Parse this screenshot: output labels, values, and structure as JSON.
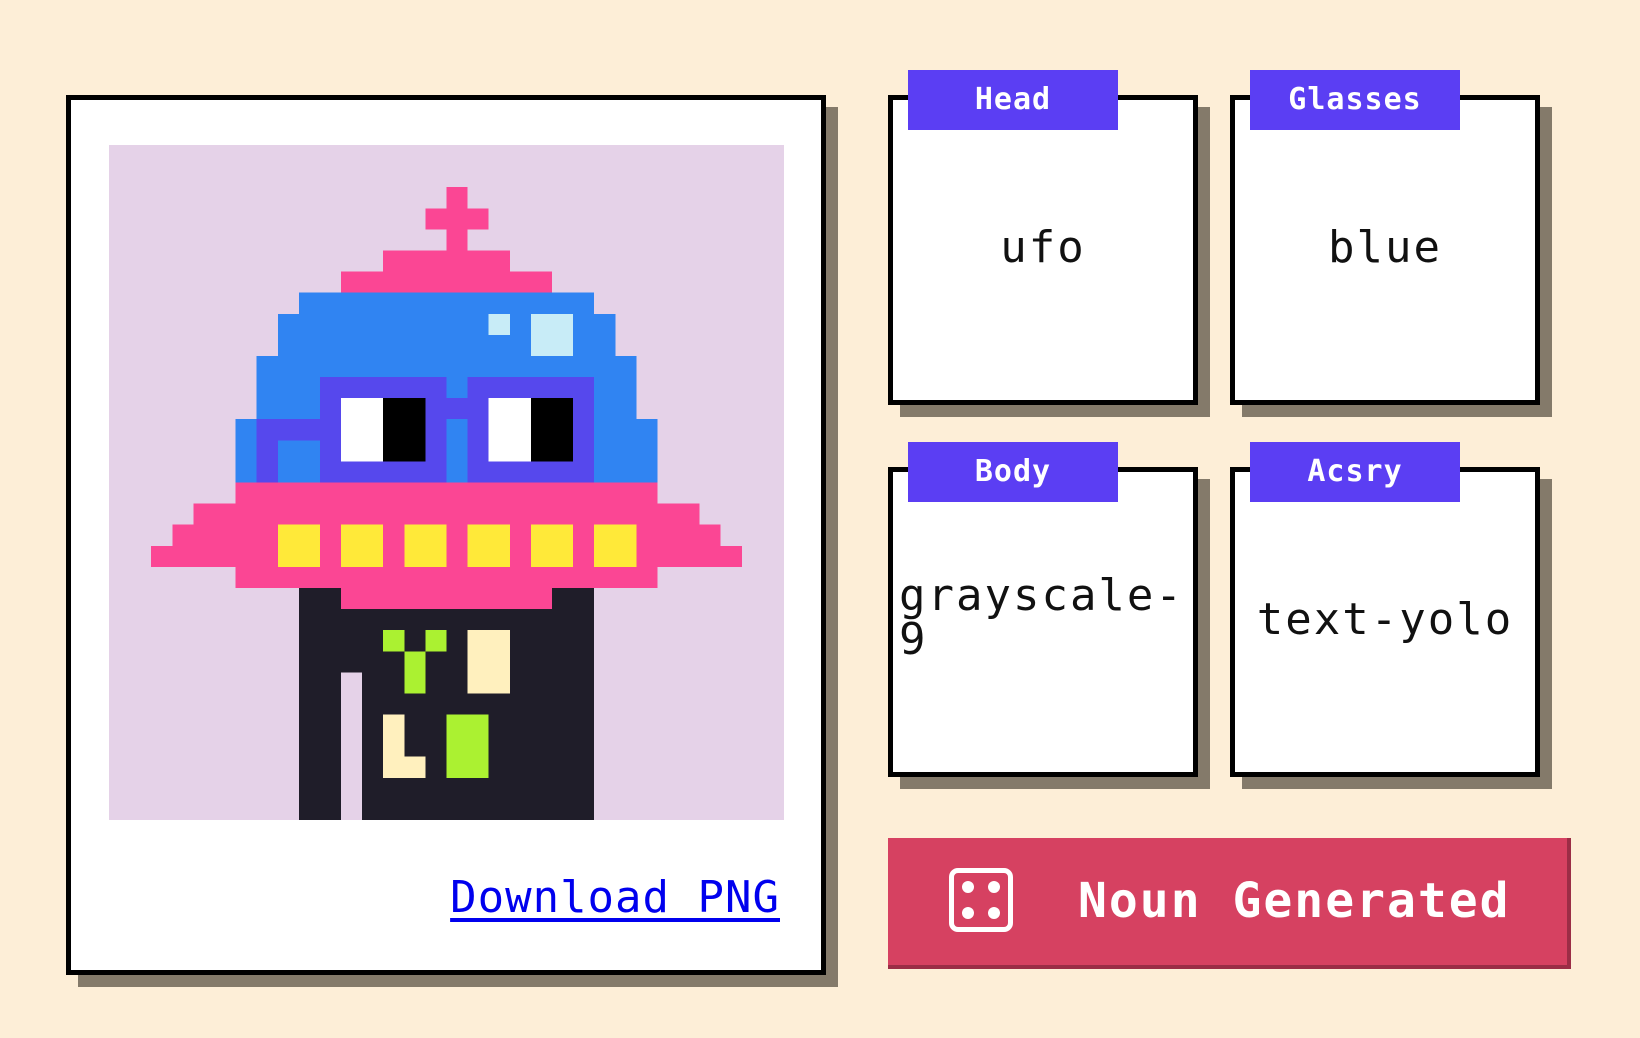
{
  "preview": {
    "download_label": "Download PNG",
    "background_color": "#e5d2e8"
  },
  "traits": [
    {
      "label": "Head",
      "value": "ufo"
    },
    {
      "label": "Glasses",
      "value": "blue"
    },
    {
      "label": "Body",
      "value": "grayscale-9"
    },
    {
      "label": "Acsry",
      "value": "text-yolo"
    }
  ],
  "generate_button": {
    "label": "Noun Generated",
    "icon": "dice-icon"
  },
  "colors": {
    "page_background": "#fdeed7",
    "trait_tab": "#5b3ef3",
    "button": "#d64161",
    "link": "#0000ee"
  }
}
